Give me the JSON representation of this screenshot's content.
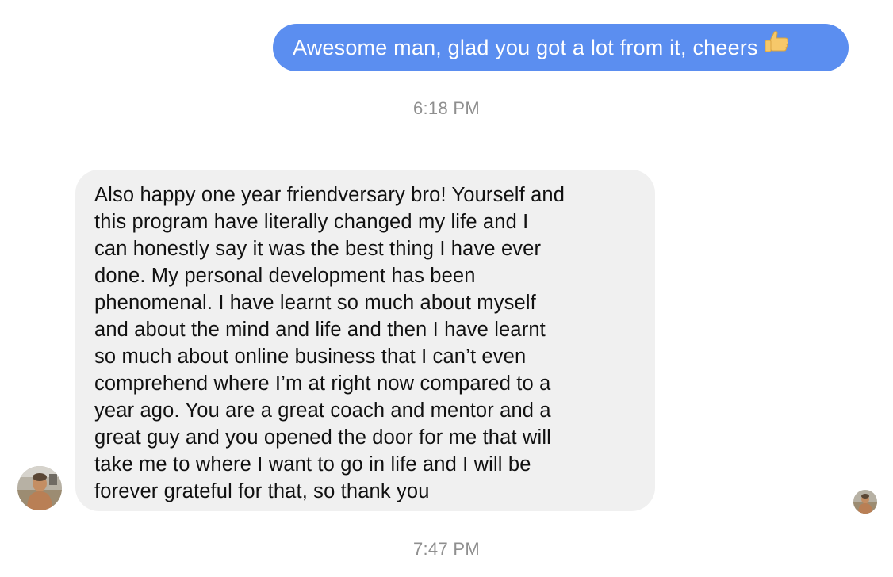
{
  "conversation": {
    "outgoing": {
      "text": "Awesome man, glad you got a lot from it, cheers",
      "emoji": "thumbs-up-icon"
    },
    "timestamp_1": "6:18 PM",
    "incoming": {
      "lines": [
        "Also happy one year friendversary bro! Yourself and",
        "this program have literally changed my life and I",
        "can honestly say it was the best thing I have ever",
        "done. My personal development has been",
        "phenomenal. I have learnt so much about myself",
        "and about the mind and life and then I have learnt",
        "so much about online business that I can’t even",
        "comprehend where I’m at right now compared to a",
        "year ago. You are a great coach and mentor and a",
        "great guy and you opened the door for me that will",
        "take me to where I want to go in life and I will be",
        "forever grateful for that, so thank you"
      ]
    },
    "timestamp_2": "7:47 PM"
  },
  "colors": {
    "outgoing_bubble": "#5b8ef0",
    "incoming_bubble": "#f0f0f0",
    "timestamp_text": "#8f8f8f"
  }
}
